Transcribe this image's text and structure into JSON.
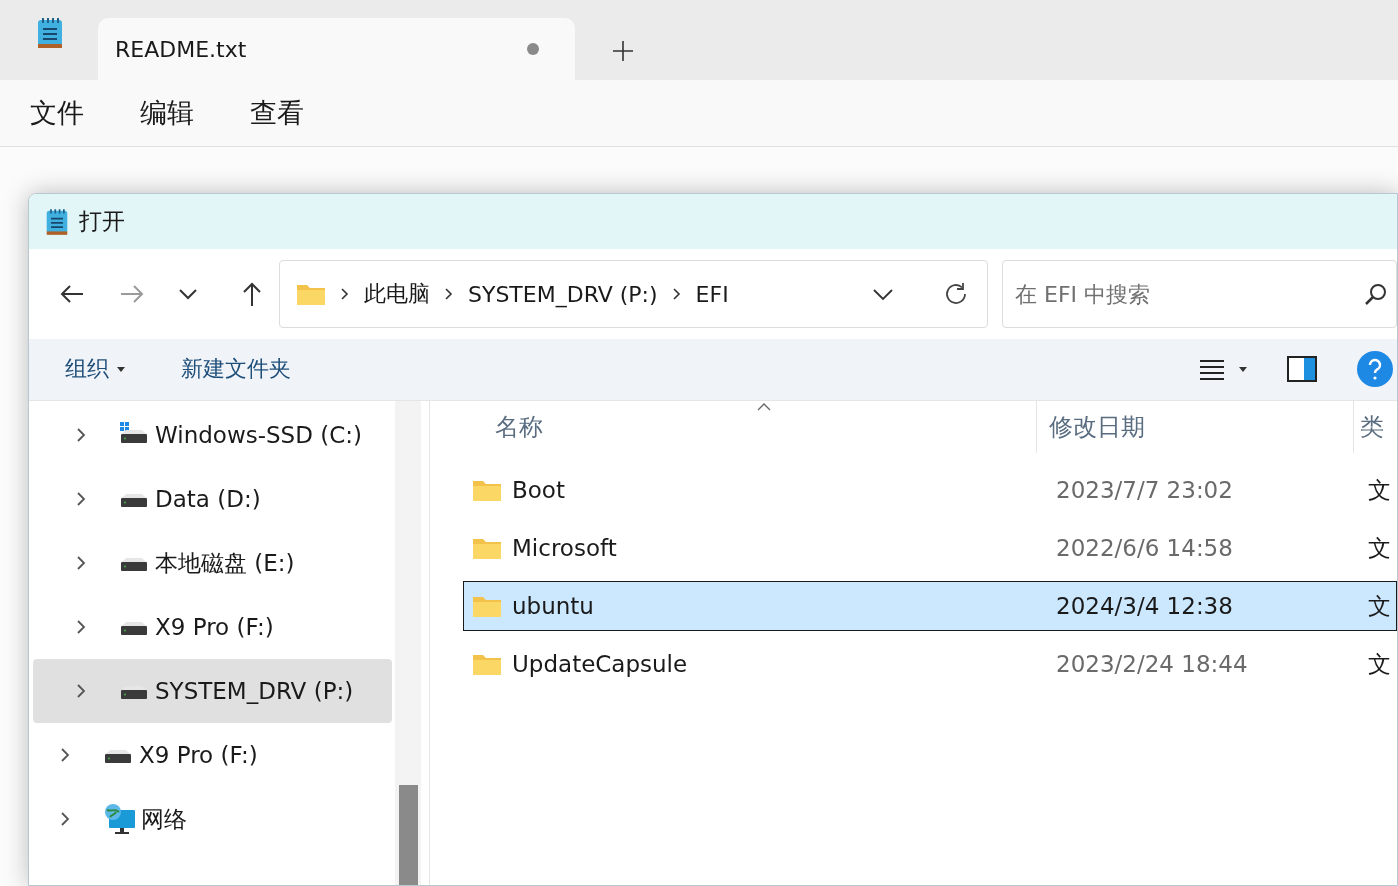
{
  "notepad": {
    "tabs": [
      {
        "title": "README.txt",
        "selected": true,
        "unsaved": true
      }
    ],
    "menu": [
      "文件",
      "编辑",
      "查看"
    ]
  },
  "dialog": {
    "title": "打开",
    "address": {
      "crumbs": [
        "此电脑",
        "SYSTEM_DRV (P:)",
        "EFI"
      ]
    },
    "search": {
      "placeholder": "在 EFI 中搜索"
    },
    "commands": [
      "组织",
      "新建文件夹"
    ],
    "nav": {
      "nested": [
        {
          "label": "Windows-SSD (C:)",
          "kind": "system",
          "expanded": false,
          "selected": false
        },
        {
          "label": "Data (D:)",
          "kind": "drive",
          "expanded": false,
          "selected": false
        },
        {
          "label": "本地磁盘 (E:)",
          "kind": "drive",
          "expanded": false,
          "selected": false
        },
        {
          "label": "X9 Pro (F:)",
          "kind": "drive",
          "expanded": false,
          "selected": false
        },
        {
          "label": "SYSTEM_DRV (P:)",
          "kind": "drive",
          "expanded": false,
          "selected": true
        }
      ],
      "items": [
        {
          "label": "X9 Pro (F:)",
          "kind": "drive",
          "expanded": false,
          "selected": false
        },
        {
          "label": "网络",
          "kind": "network",
          "expanded": false,
          "selected": false
        }
      ]
    },
    "files": {
      "columns": [
        "名称",
        "修改日期",
        "类"
      ],
      "rows": [
        {
          "name": "Boot",
          "date": "2023/7/7 23:02",
          "column_3": "文",
          "selected": false
        },
        {
          "name": "Microsoft",
          "date": "2022/6/6 14:58",
          "column_3": "文",
          "selected": false
        },
        {
          "name": "ubuntu",
          "date": "2024/3/4 12:38",
          "column_3": "文",
          "selected": true
        },
        {
          "name": "UpdateCapsule",
          "date": "2023/2/24 18:44",
          "column_3": "文",
          "selected": false
        }
      ]
    }
  }
}
